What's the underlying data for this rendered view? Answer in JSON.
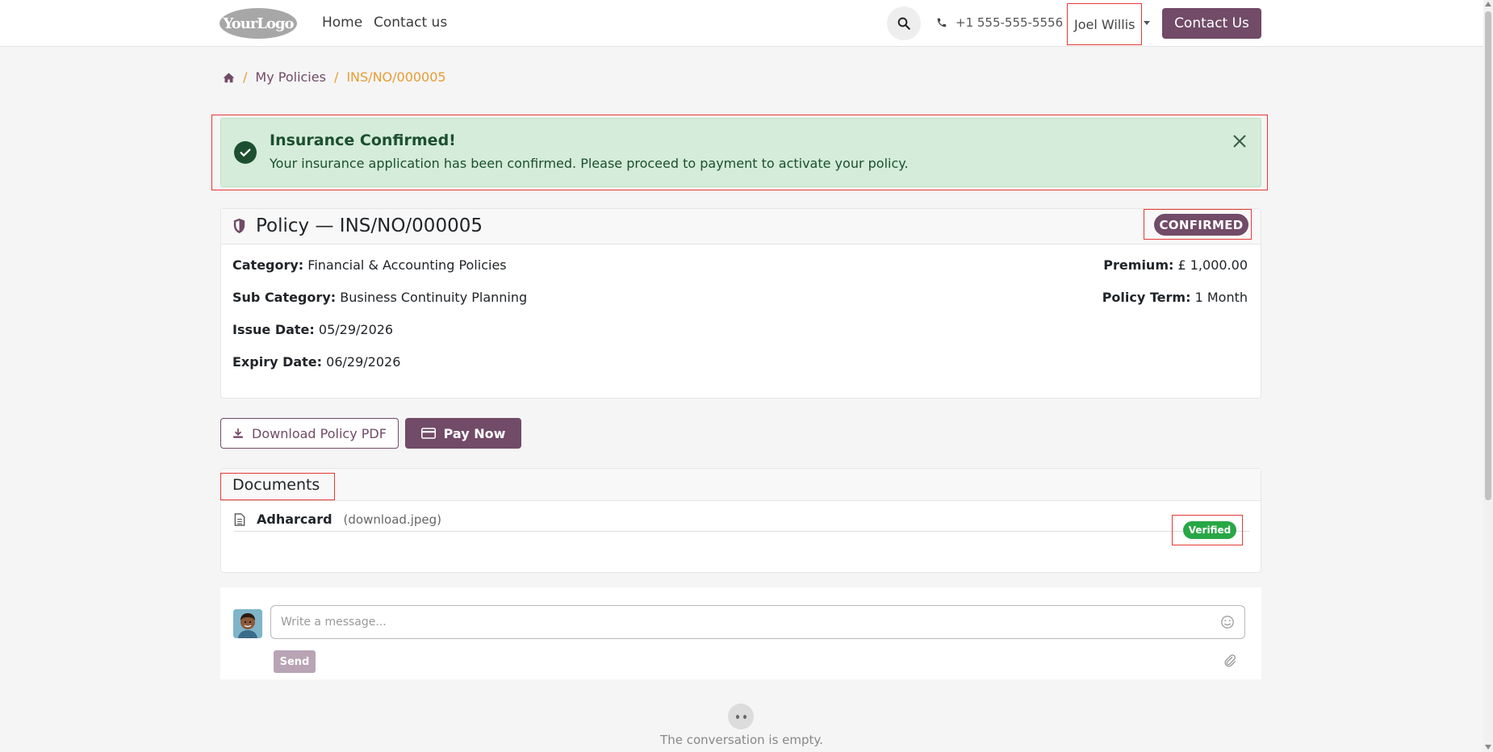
{
  "header": {
    "logo_text": "YourLogo",
    "nav": [
      "Home",
      "Contact us"
    ],
    "phone": "+1 555-555-5556",
    "user": "Joel Willis",
    "contact_button": "Contact Us"
  },
  "breadcrumb": {
    "home_icon": "home-icon",
    "items": [
      "My Policies",
      "INS/NO/000005"
    ],
    "separator": "/"
  },
  "alert": {
    "title": "Insurance Confirmed!",
    "text": "Your insurance application has been confirmed. Please proceed to payment to activate your policy."
  },
  "policy": {
    "title": "Policy — INS/NO/000005",
    "status": "CONFIRMED",
    "fields_left": [
      {
        "label": "Category:",
        "value": "Financial & Accounting Policies"
      },
      {
        "label": "Sub Category:",
        "value": "Business Continuity Planning"
      },
      {
        "label": "Issue Date:",
        "value": "05/29/2026"
      },
      {
        "label": "Expiry Date:",
        "value": "06/29/2026"
      }
    ],
    "fields_right": [
      {
        "label": "Premium:",
        "value": "£ 1,000.00"
      },
      {
        "label": "Policy Term:",
        "value": "1 Month"
      }
    ]
  },
  "actions": {
    "download": "Download Policy PDF",
    "pay": "Pay Now"
  },
  "documents": {
    "title": "Documents",
    "items": [
      {
        "name": "Adharcard",
        "file": "(download.jpeg)",
        "status": "Verified"
      }
    ]
  },
  "chatter": {
    "placeholder": "Write a message...",
    "send": "Send",
    "empty": "The conversation is empty."
  },
  "colors": {
    "brand": "#714b67",
    "breadcrumb_active": "#e89c33",
    "success_bg": "#d4ecd9",
    "verified": "#28a745"
  }
}
